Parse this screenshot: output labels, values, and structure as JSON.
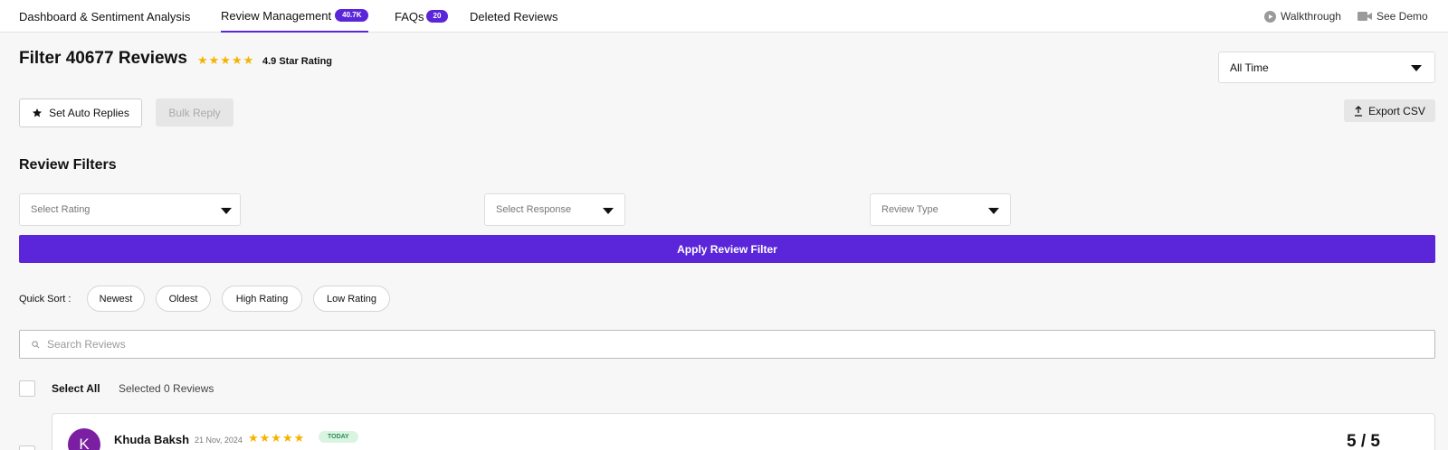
{
  "tabs": [
    {
      "label": "Dashboard & Sentiment Analysis"
    },
    {
      "label": "Review Management",
      "badge": "40.7K"
    },
    {
      "label": "FAQs",
      "badge": "20"
    },
    {
      "label": "Deleted Reviews"
    }
  ],
  "header_links": {
    "walkthrough": "Walkthrough",
    "see_demo": "See Demo"
  },
  "heading": {
    "title": "Filter 40677 Reviews",
    "stars": "★★★★★",
    "rating": "4.9 Star Rating"
  },
  "time_select": {
    "value": "All Time"
  },
  "actions": {
    "auto_replies": "Set Auto Replies",
    "bulk_reply": "Bulk Reply",
    "export_csv": "Export CSV"
  },
  "filters": {
    "title": "Review Filters",
    "rating_placeholder": "Select Rating",
    "response_placeholder": "Select Response",
    "type_placeholder": "Review Type",
    "apply": "Apply Review Filter"
  },
  "quick_sort": {
    "label": "Quick Sort :",
    "options": [
      "Newest",
      "Oldest",
      "High Rating",
      "Low Rating"
    ]
  },
  "search": {
    "placeholder": "Search Reviews"
  },
  "selection": {
    "select_all": "Select All",
    "selected_text": "Selected 0 Reviews"
  },
  "reviews": [
    {
      "avatar": "K",
      "name": "Khuda Baksh",
      "date": "21 Nov, 2024",
      "stars": "★★★★★",
      "tag": "TODAY",
      "score": "5 / 5"
    }
  ],
  "colors": {
    "accent": "#5b26d9",
    "star": "#f5b301",
    "avatar": "#7a1fa2",
    "today_bg": "#d9f5e2",
    "today_text": "#2e8b57"
  }
}
